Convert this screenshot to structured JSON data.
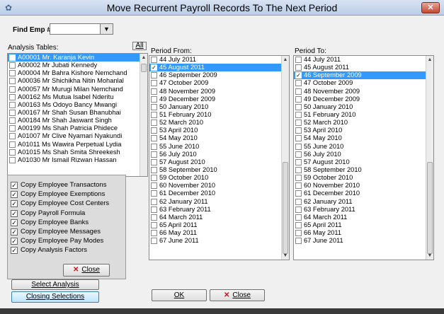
{
  "window": {
    "title": "Move Recurrent Payroll Records To The Next Period",
    "close": "✕"
  },
  "find": {
    "label": "Find Emp #:",
    "value": ""
  },
  "analysis": {
    "label": "Analysis Tables:",
    "all_label": "All",
    "items": [
      {
        "text": "A00001 Mr. Karanja Kevin",
        "selected": true
      },
      {
        "text": "A00002 Mr Jubati Kennedy"
      },
      {
        "text": "A00004 Mr Bahra Kishore Nemchand"
      },
      {
        "text": "A00036 Mr Shichikha Nitin Mohanlal"
      },
      {
        "text": "A00057 Mr Murugi Milan Nemchand"
      },
      {
        "text": "A00162 Ms Mutua Isabel Nderitu"
      },
      {
        "text": "A00163 Ms Odoyo Bancy Mwangi"
      },
      {
        "text": "A00167 Mr Shah Susan Bhanubhai"
      },
      {
        "text": "A00184 Mr Shah Jaswant Singh"
      },
      {
        "text": "A00199 Ms Shah Patricia Phidece"
      },
      {
        "text": "A01007 Mr Clive Nyamari Nyakundi"
      },
      {
        "text": "A01011 Ms Wawira Perpetual Lydia"
      },
      {
        "text": "A01015 Ms Shah Smita Shreekesh"
      },
      {
        "text": "A01030 Mr Ismail Rizwan Hassan"
      }
    ]
  },
  "copy_options": [
    {
      "label": "Copy Employee Transactons",
      "checked": true
    },
    {
      "label": "Copy Employee Exemptions",
      "checked": true
    },
    {
      "label": "Copy Employee Cost Centers",
      "checked": true
    },
    {
      "label": "Copy Payroll Formula",
      "checked": true
    },
    {
      "label": "Copy Employee Banks",
      "checked": true
    },
    {
      "label": "Copy Employee Messages",
      "checked": true
    },
    {
      "label": "Copy Employee Pay Modes",
      "checked": true
    },
    {
      "label": "Copy Analysis Factors",
      "checked": true
    }
  ],
  "copy_close_label": "Close",
  "period_from": {
    "label": "Period From:",
    "items": [
      {
        "text": "44 July 2011"
      },
      {
        "text": "45 August 2011",
        "checked": true,
        "selected": true
      },
      {
        "text": "46 September 2009"
      },
      {
        "text": "47 October 2009"
      },
      {
        "text": "48 November 2009"
      },
      {
        "text": "49 December 2009"
      },
      {
        "text": "50 January 2010"
      },
      {
        "text": "51 February 2010"
      },
      {
        "text": "52 March 2010"
      },
      {
        "text": "53 April 2010"
      },
      {
        "text": "54 May 2010"
      },
      {
        "text": "55 June 2010"
      },
      {
        "text": "56 July 2010"
      },
      {
        "text": "57 August 2010"
      },
      {
        "text": "58 September 2010"
      },
      {
        "text": "59 October 2010"
      },
      {
        "text": "60 November 2010"
      },
      {
        "text": "61 December 2010"
      },
      {
        "text": "62 January 2011"
      },
      {
        "text": "63 February 2011"
      },
      {
        "text": "64 March 2011"
      },
      {
        "text": "65 April 2011"
      },
      {
        "text": "66 May 2011"
      },
      {
        "text": "67 June 2011"
      }
    ]
  },
  "period_to": {
    "label": "Period To:",
    "items": [
      {
        "text": "44 July 2011"
      },
      {
        "text": "45 August 2011"
      },
      {
        "text": "46 September 2009",
        "checked": true,
        "selected": true
      },
      {
        "text": "47 October 2009"
      },
      {
        "text": "48 November 2009"
      },
      {
        "text": "49 December 2009"
      },
      {
        "text": "50 January 2010"
      },
      {
        "text": "51 February 2010"
      },
      {
        "text": "52 March 2010"
      },
      {
        "text": "53 April 2010"
      },
      {
        "text": "54 May 2010"
      },
      {
        "text": "55 June 2010"
      },
      {
        "text": "56 July 2010"
      },
      {
        "text": "57 August 2010"
      },
      {
        "text": "58 September 2010"
      },
      {
        "text": "59 October 2010"
      },
      {
        "text": "60 November 2010"
      },
      {
        "text": "61 December 2010"
      },
      {
        "text": "62 January 2011"
      },
      {
        "text": "63 February 2011"
      },
      {
        "text": "64 March 2011"
      },
      {
        "text": "65 April 2011"
      },
      {
        "text": "66 May 2011"
      },
      {
        "text": "67 June 2011"
      }
    ]
  },
  "buttons": {
    "select_analysis": "Select Analysis",
    "closing_selections": "Closing Selections",
    "ok": "OK",
    "close": "Close"
  }
}
